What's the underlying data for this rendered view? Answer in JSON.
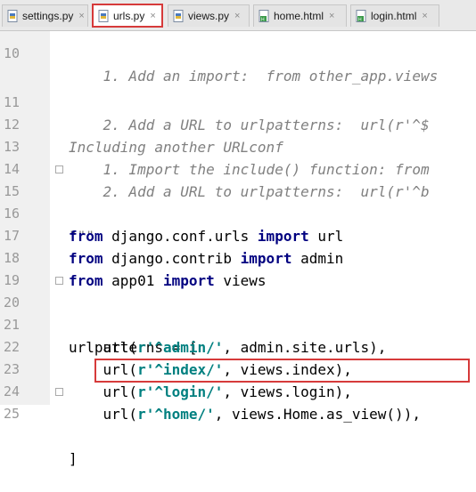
{
  "tabs": [
    {
      "label": "settings.py",
      "icon": "python-file-icon"
    },
    {
      "label": "urls.py",
      "icon": "python-file-icon",
      "active": true
    },
    {
      "label": "views.py",
      "icon": "python-file-icon"
    },
    {
      "label": "home.html",
      "icon": "html-file-icon"
    },
    {
      "label": "login.html",
      "icon": "html-file-icon"
    }
  ],
  "tab_close": "×",
  "lines": [
    {
      "num": "10",
      "text": "    1. Add an import:  from other_app.views"
    },
    {
      "num": "11",
      "text": "    2. Add a URL to urlpatterns:  url(r'^$"
    },
    {
      "num": "12",
      "text": "Including another URLconf"
    },
    {
      "num": "13",
      "text": "    1. Import the include() function: from"
    },
    {
      "num": "14",
      "text": "    2. Add a URL to urlpatterns:  url(r'^b"
    },
    {
      "num": "15",
      "text": "\"\"\""
    },
    {
      "num": "16",
      "kw1": "from",
      "mid": " django.conf.urls ",
      "kw2": "import",
      "end": " url"
    },
    {
      "num": "17",
      "kw1": "from",
      "mid": " django.contrib ",
      "kw2": "import",
      "end": " admin"
    },
    {
      "num": "18",
      "kw1": "from",
      "mid": " app01 ",
      "kw2": "import",
      "end": " views"
    },
    {
      "num": "19",
      "text": ""
    },
    {
      "num": "20",
      "text": "urlpatterns = ["
    },
    {
      "num": "21",
      "pre": "    url(",
      "str": "r'^admin/'",
      "post": ", admin.site.urls),"
    },
    {
      "num": "22",
      "pre": "    url(",
      "str": "r'^index/'",
      "post": ", views.index),"
    },
    {
      "num": "23",
      "pre": "    url(",
      "str": "r'^login/'",
      "post": ", views.login),"
    },
    {
      "num": "24",
      "pre": "    url(",
      "str": "r'^home/'",
      "post": ", views.Home.as_view()),"
    },
    {
      "num": "25",
      "text": "]"
    }
  ]
}
